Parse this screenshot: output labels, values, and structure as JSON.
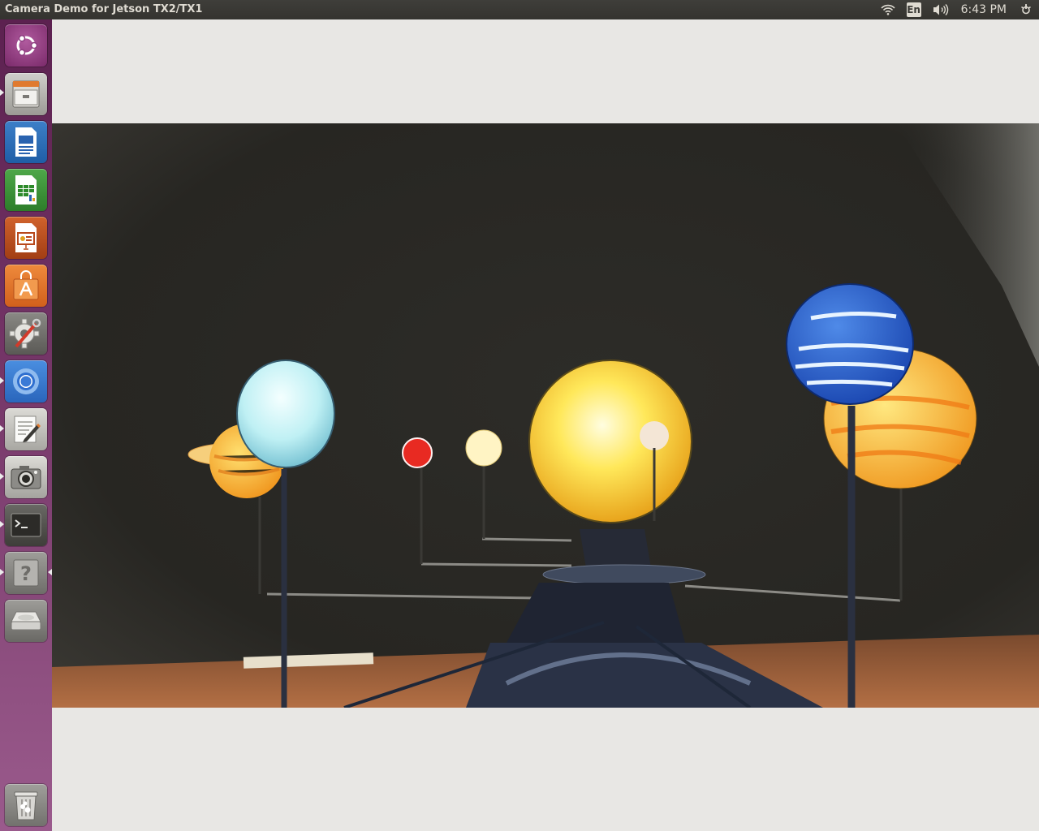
{
  "window": {
    "title": "Camera Demo for Jetson TX2/TX1"
  },
  "panel": {
    "language": "En",
    "clock": "6:43 PM",
    "icons": [
      "wifi-icon",
      "keyboard-language-icon",
      "volume-icon",
      "system-gear-icon"
    ]
  },
  "launcher": {
    "items": [
      {
        "name": "ubuntu-dash",
        "icon": "ubuntu-logo-icon"
      },
      {
        "name": "files",
        "icon": "file-cabinet-icon"
      },
      {
        "name": "libreoffice-writer",
        "icon": "writer-document-icon"
      },
      {
        "name": "libreoffice-calc",
        "icon": "calc-spreadsheet-icon"
      },
      {
        "name": "libreoffice-impress",
        "icon": "impress-presentation-icon"
      },
      {
        "name": "software-center",
        "icon": "shopping-bag-icon"
      },
      {
        "name": "system-settings",
        "icon": "settings-wrench-icon"
      },
      {
        "name": "chromium",
        "icon": "chromium-browser-icon"
      },
      {
        "name": "text-editor",
        "icon": "text-editor-icon"
      },
      {
        "name": "camera-demo",
        "icon": "camera-icon"
      },
      {
        "name": "terminal",
        "icon": "terminal-icon"
      },
      {
        "name": "help",
        "icon": "help-question-icon"
      },
      {
        "name": "disk-drive",
        "icon": "disk-drive-icon"
      },
      {
        "name": "trash",
        "icon": "trash-icon"
      }
    ]
  },
  "colors": {
    "panel": "#3c3b37",
    "launcher_top": "#5c2150",
    "launcher_bottom": "#9a5a8c",
    "window_bg": "#e8e7e4"
  },
  "camera_feed": {
    "subject": "solar-system-model-photo"
  }
}
